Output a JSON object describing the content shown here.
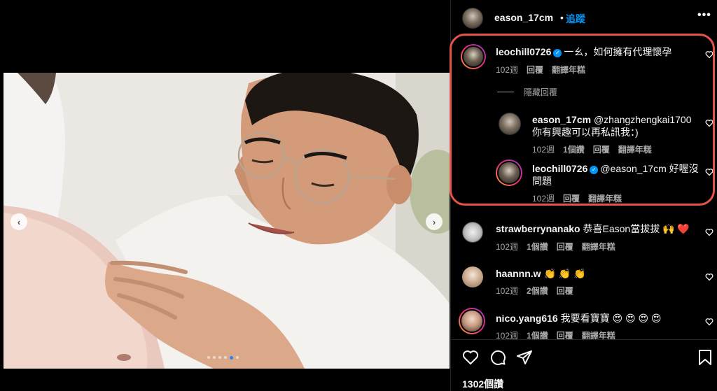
{
  "post": {
    "username": "eason_17cm",
    "separator": "•",
    "follow_label": "追蹤",
    "more_label": "•••",
    "likes_label": "1302個讚",
    "carousel": {
      "dot_count": 6,
      "active_index": 4
    }
  },
  "comments": [
    {
      "username": "leochill0726",
      "verified": true,
      "text": "一ㄠ，如何擁有代理懷孕",
      "time": "102週",
      "reply": "回覆",
      "translate": "翻譯年糕",
      "likes": ""
    },
    {
      "username": "eason_17cm",
      "verified": false,
      "text": "@zhangzhengkai1700",
      "text2": "你有興趣可以再私訊我：)",
      "time": "102週",
      "likes": "1個讚",
      "reply": "回覆",
      "translate": "翻譯年糕"
    },
    {
      "username": "leochill0726",
      "verified": true,
      "text": "@eason_17cm 好喔沒",
      "text2": "問題",
      "time": "102週",
      "reply": "回覆",
      "translate": "翻譯年糕"
    },
    {
      "username": "strawberrynanako",
      "verified": false,
      "text": "恭喜Eason當拔拔 🙌 ❤️",
      "time": "102週",
      "likes": "1個讚",
      "reply": "回覆",
      "translate": "翻譯年糕"
    },
    {
      "username": "haannn.w",
      "verified": false,
      "text": "👏 👏 👏",
      "time": "102週",
      "likes": "2個讚",
      "reply": "回覆"
    },
    {
      "username": "nico.yang616",
      "verified": false,
      "text": "我要看寶寶 😍 😍 😍 😍",
      "time": "102週",
      "likes": "1個讚",
      "reply": "回覆",
      "translate": "翻譯年糕"
    }
  ],
  "hide_replies_label": "隱藏回覆",
  "icons": [
    "heart-icon",
    "comment-icon",
    "share-icon",
    "bookmark-icon",
    "chevron-left-icon",
    "chevron-right-icon",
    "verified-icon"
  ]
}
